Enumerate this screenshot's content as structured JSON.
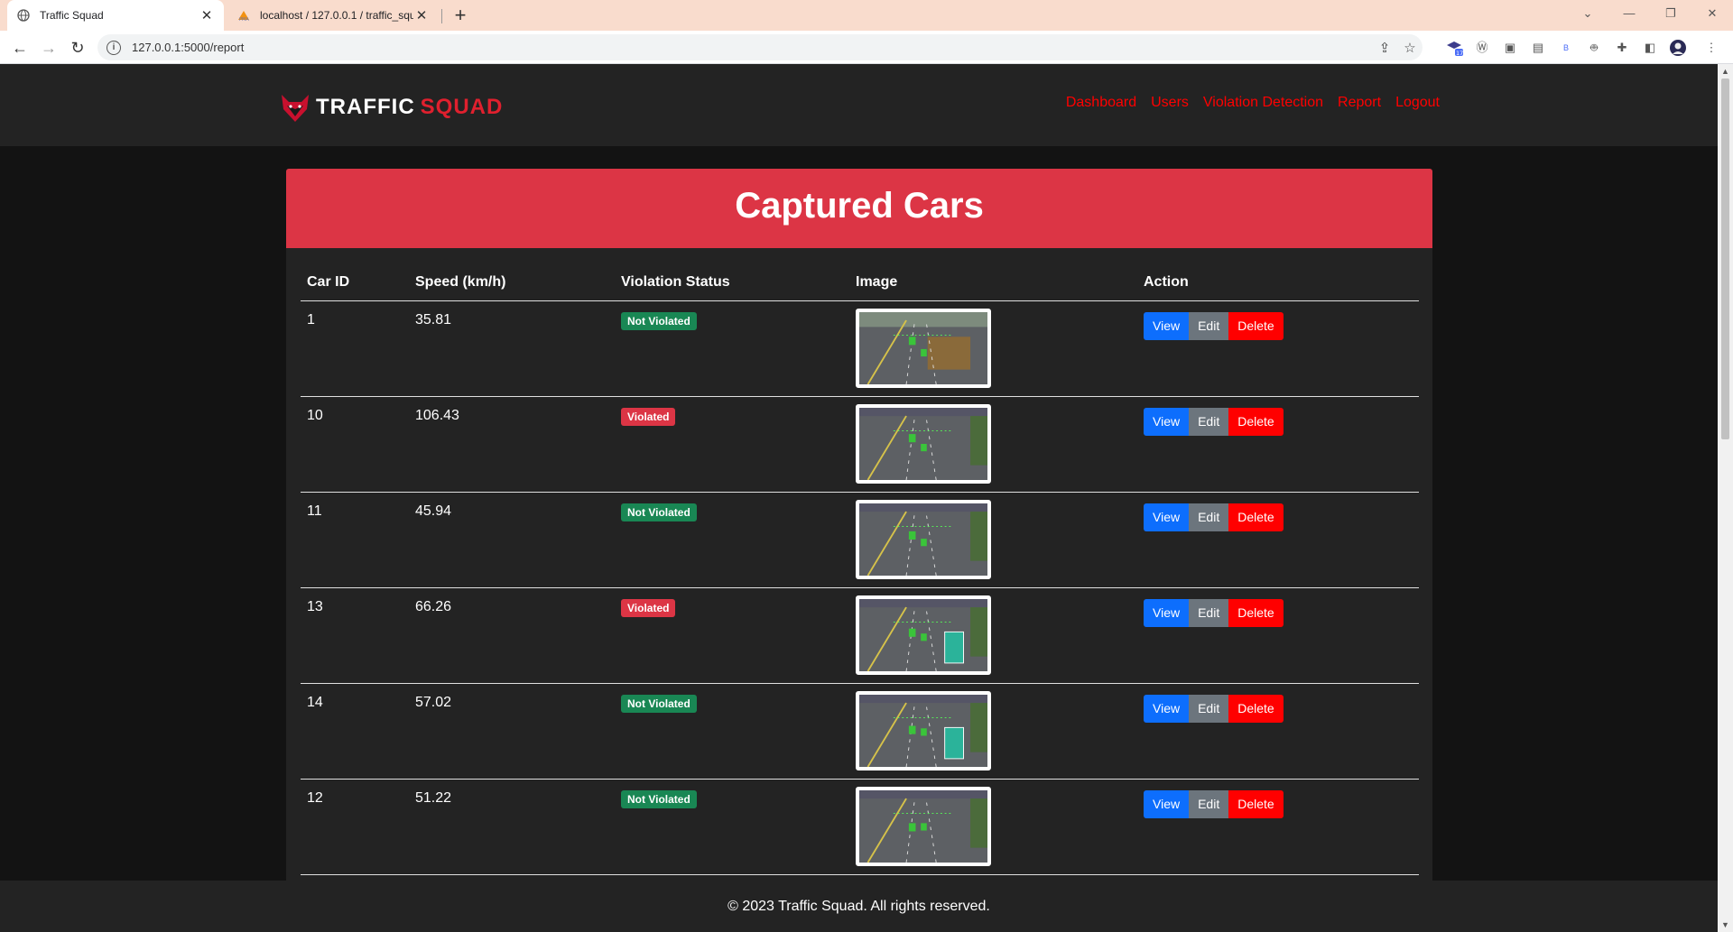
{
  "browser": {
    "tabs": [
      {
        "title": "Traffic Squad",
        "icon": "globe-icon"
      },
      {
        "title": "localhost / 127.0.0.1 / traffic_squ",
        "icon": "phpmyadmin-icon"
      }
    ],
    "url": "127.0.0.1:5000/report",
    "profile_badge": "17"
  },
  "site": {
    "brand_part1": "TRAFFIC",
    "brand_part2": "SQUAD",
    "nav": [
      "Dashboard",
      "Users",
      "Violation Detection",
      "Report",
      "Logout"
    ]
  },
  "report": {
    "title": "Captured Cars",
    "columns": [
      "Car ID",
      "Speed (km/h)",
      "Violation Status",
      "Image",
      "Action"
    ],
    "rows": [
      {
        "id": "1",
        "speed": "35.81",
        "status": "Not Violated"
      },
      {
        "id": "10",
        "speed": "106.43",
        "status": "Violated"
      },
      {
        "id": "11",
        "speed": "45.94",
        "status": "Not Violated"
      },
      {
        "id": "13",
        "speed": "66.26",
        "status": "Violated"
      },
      {
        "id": "14",
        "speed": "57.02",
        "status": "Not Violated"
      },
      {
        "id": "12",
        "speed": "51.22",
        "status": "Not Violated"
      }
    ],
    "actions": {
      "view": "View",
      "edit": "Edit",
      "delete": "Delete"
    }
  },
  "footer": {
    "text": "© 2023 Traffic Squad. All rights reserved."
  },
  "colors": {
    "accent_red": "#dc3545",
    "nav_red": "#ff0000",
    "ok_green": "#198754",
    "view_blue": "#0d6efd",
    "edit_gray": "#6c757d"
  }
}
